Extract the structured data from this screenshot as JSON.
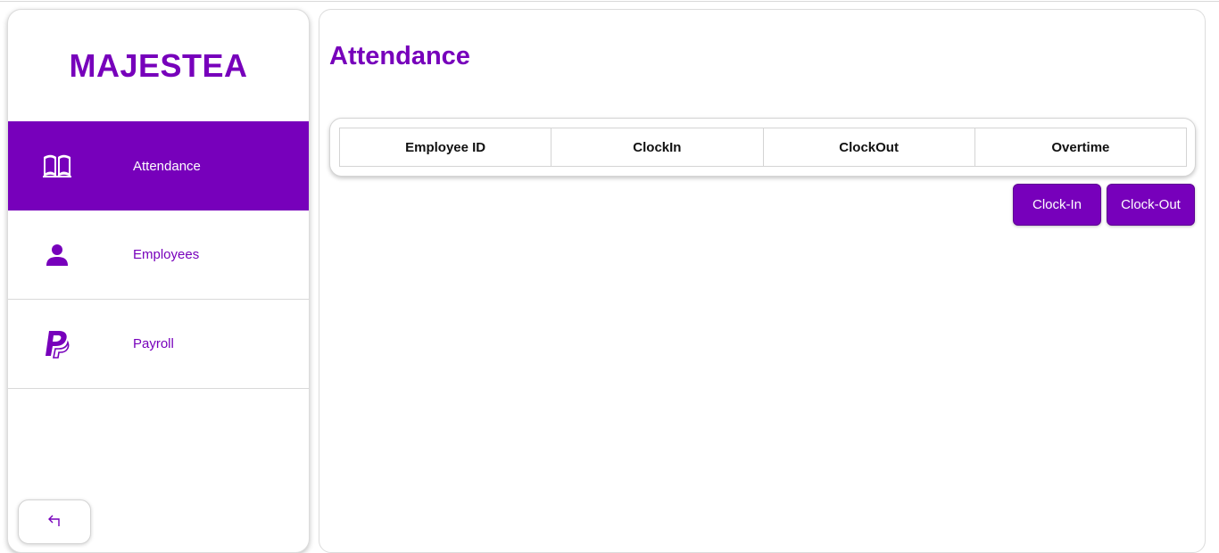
{
  "brand": "MAJESTEA",
  "sidebar": {
    "items": [
      {
        "label": "Attendance",
        "icon": "book-open-icon",
        "active": true
      },
      {
        "label": "Employees",
        "icon": "user-icon",
        "active": false
      },
      {
        "label": "Payroll",
        "icon": "paypal-icon",
        "active": false
      }
    ],
    "back_icon": "arrow-return-left-icon"
  },
  "main": {
    "title": "Attendance",
    "table": {
      "columns": [
        "Employee ID",
        "ClockIn",
        "ClockOut",
        "Overtime"
      ]
    },
    "actions": {
      "clock_in": "Clock-In",
      "clock_out": "Clock-Out"
    }
  },
  "colors": {
    "accent": "#7700bb",
    "border": "#d4d4d4"
  }
}
